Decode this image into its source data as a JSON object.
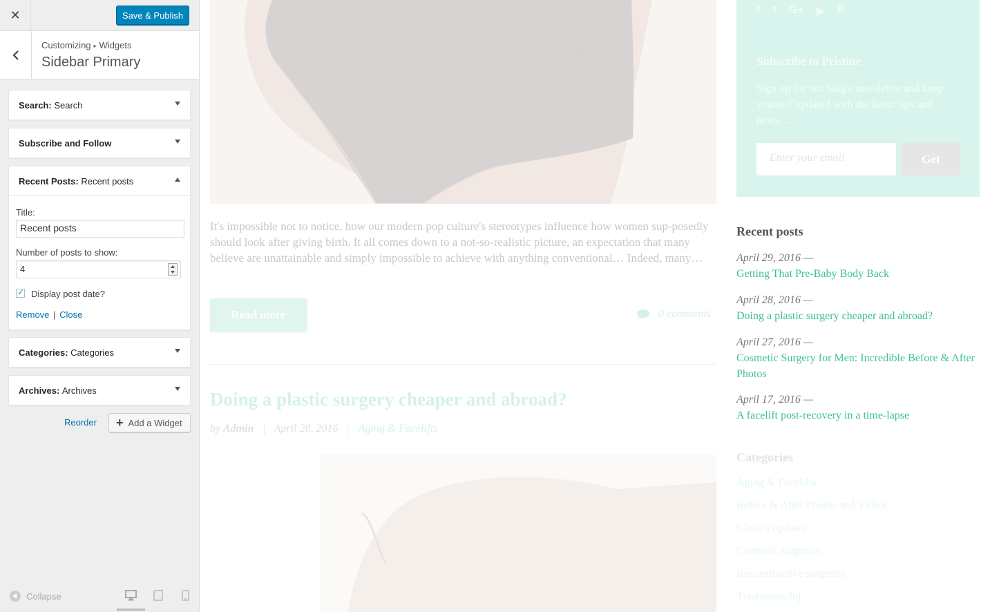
{
  "colors": {
    "accent": "#0085ba",
    "link": "#0073aa",
    "mint": "#3cbf9a",
    "panel_bg": "#eeeeee"
  },
  "header": {
    "close_icon": "close-icon",
    "publish_label": "Save & Publish"
  },
  "titlebar": {
    "crumb_root": "Customizing",
    "crumb_child": "Widgets",
    "section": "Sidebar Primary"
  },
  "widgets": [
    {
      "type": "Search:",
      "name": "Search"
    },
    {
      "type": "Subscribe and Follow",
      "name": ""
    },
    {
      "type": "Recent Posts:",
      "name": "Recent posts"
    },
    {
      "type": "Categories:",
      "name": "Categories"
    },
    {
      "type": "Archives:",
      "name": "Archives"
    }
  ],
  "recent_form": {
    "title_label": "Title:",
    "title_value": "Recent posts",
    "count_label": "Number of posts to show:",
    "count_value": "4",
    "date_label": "Display post date?",
    "date_checked": true,
    "remove": "Remove",
    "sep": "|",
    "close": "Close"
  },
  "actions": {
    "reorder": "Reorder",
    "add_widget": "Add a Widget"
  },
  "footer": {
    "collapse": "Collapse",
    "devices": [
      "desktop-icon",
      "tablet-icon",
      "mobile-icon"
    ]
  },
  "preview": {
    "excerpt": "It's impossible not to notice, how our modern pop culture's stereotypes influence how women sup-posedly should look after giving birth. It all comes down to a not-so-realistic picture, an expectation that many believe are unattainable and simply impossible to achieve with anything conventional… Indeed, many…",
    "read_more": "Read more",
    "comments": "0 comments",
    "post2_title": "Doing a plastic surgery cheaper and abroad?",
    "post2_by": "by",
    "post2_author": "Admin",
    "post2_date": "April 28, 2016",
    "post2_category": "Aging & Facelifts"
  },
  "subscribe": {
    "social": [
      "facebook-icon",
      "twitter-icon",
      "google-plus-icon",
      "youtube-icon",
      "pinterest-icon"
    ],
    "title": "Subscribe to Pristine",
    "text": "Sign up for our blog's newsletter and keep yourself updated with the latest tips and news…",
    "placeholder": "Enter your email",
    "button": "Get"
  },
  "recent_posts": {
    "title": "Recent posts",
    "items": [
      {
        "date": "April 29, 2016 —",
        "title": "Getting That Pre-Baby Body Back"
      },
      {
        "date": "April 28, 2016 —",
        "title": "Doing a plastic surgery cheaper and abroad?"
      },
      {
        "date": "April 27, 2016 —",
        "title": "Cosmetic Surgery for Men: Incredible Before & After Photos"
      },
      {
        "date": "April 17, 2016 —",
        "title": "A facelift post-recovery in a time-lapse"
      }
    ]
  },
  "categories": {
    "title": "Categories",
    "items": [
      "Aging & Facelifts",
      "Before & After Photos and Videos",
      "Clinic's updates",
      "Cosmetic surgeries",
      "Reconstructive surgeries",
      "Treatments/Inj"
    ]
  }
}
